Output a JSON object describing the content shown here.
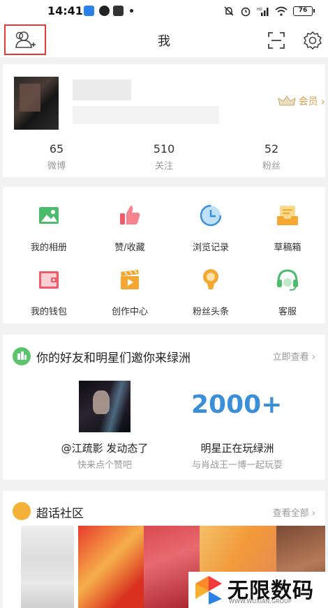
{
  "status_bar": {
    "time": "14:41",
    "battery": "76"
  },
  "header": {
    "title": "我"
  },
  "profile": {
    "vip_label": "会员",
    "stats": [
      {
        "value": "65",
        "label": "微博"
      },
      {
        "value": "510",
        "label": "关注"
      },
      {
        "value": "52",
        "label": "粉丝"
      }
    ]
  },
  "features": [
    {
      "label": "我的相册",
      "icon": "album-icon",
      "color": "#4cbb6c"
    },
    {
      "label": "赞/收藏",
      "icon": "thumbs-up-icon",
      "color": "#f25a6a"
    },
    {
      "label": "浏览记录",
      "icon": "clock-icon",
      "color": "#3a8fd8"
    },
    {
      "label": "草稿箱",
      "icon": "drafts-icon",
      "color": "#f4a831"
    },
    {
      "label": "我的钱包",
      "icon": "wallet-icon",
      "color": "#f25a6a"
    },
    {
      "label": "创作中心",
      "icon": "clapper-icon",
      "color": "#f4a831"
    },
    {
      "label": "粉丝头条",
      "icon": "bulb-icon",
      "color": "#f4a831"
    },
    {
      "label": "客服",
      "icon": "headset-icon",
      "color": "#4cbb6c"
    }
  ],
  "oasis": {
    "title": "你的好友和明星们邀你来绿洲",
    "more": "立即查看",
    "left_caption": "@江疏影 发动态了",
    "left_sub": "快来点个赞吧",
    "big_number": "2000+",
    "right_caption": "明星正在玩绿洲",
    "right_sub": "与肖战王一博一起玩耍"
  },
  "topic": {
    "title": "超话社区",
    "more": "查看全部"
  },
  "watermark": {
    "text": "无限数码",
    "url": "WWW.WUXIAN.GROUP"
  }
}
